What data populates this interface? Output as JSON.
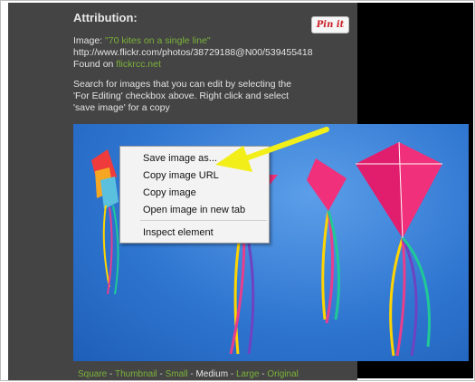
{
  "attribution": {
    "title": "Attribution:",
    "image_prefix": "Image: ",
    "image_title": "\"70 kites on a single line\"",
    "image_url": "http://www.flickr.com/photos/38729188@N00/539455418",
    "found_prefix": "Found on ",
    "found_site": "flickrcc.net",
    "instructions": [
      "Search for images that you can edit by selecting the",
      "'For Editing' checkbox above. Right click and select",
      "'save image' for a copy"
    ]
  },
  "pin_button": {
    "label": "Pin it"
  },
  "context_menu": {
    "items": [
      "Save image as...",
      "Copy image URL",
      "Copy image",
      "Open image in new tab",
      "Inspect element"
    ]
  },
  "sizes": {
    "items": [
      "Square",
      "Thumbnail",
      "Small",
      "Medium",
      "Large",
      "Original"
    ],
    "separator": " - ",
    "current": "Medium"
  },
  "colors": {
    "link_green": "#7bb23a",
    "panel_bg": "#444444",
    "kite_pink": "#f0307a",
    "sky_blue": "#2f76d1",
    "arrow_yellow": "#f2ee1a"
  }
}
